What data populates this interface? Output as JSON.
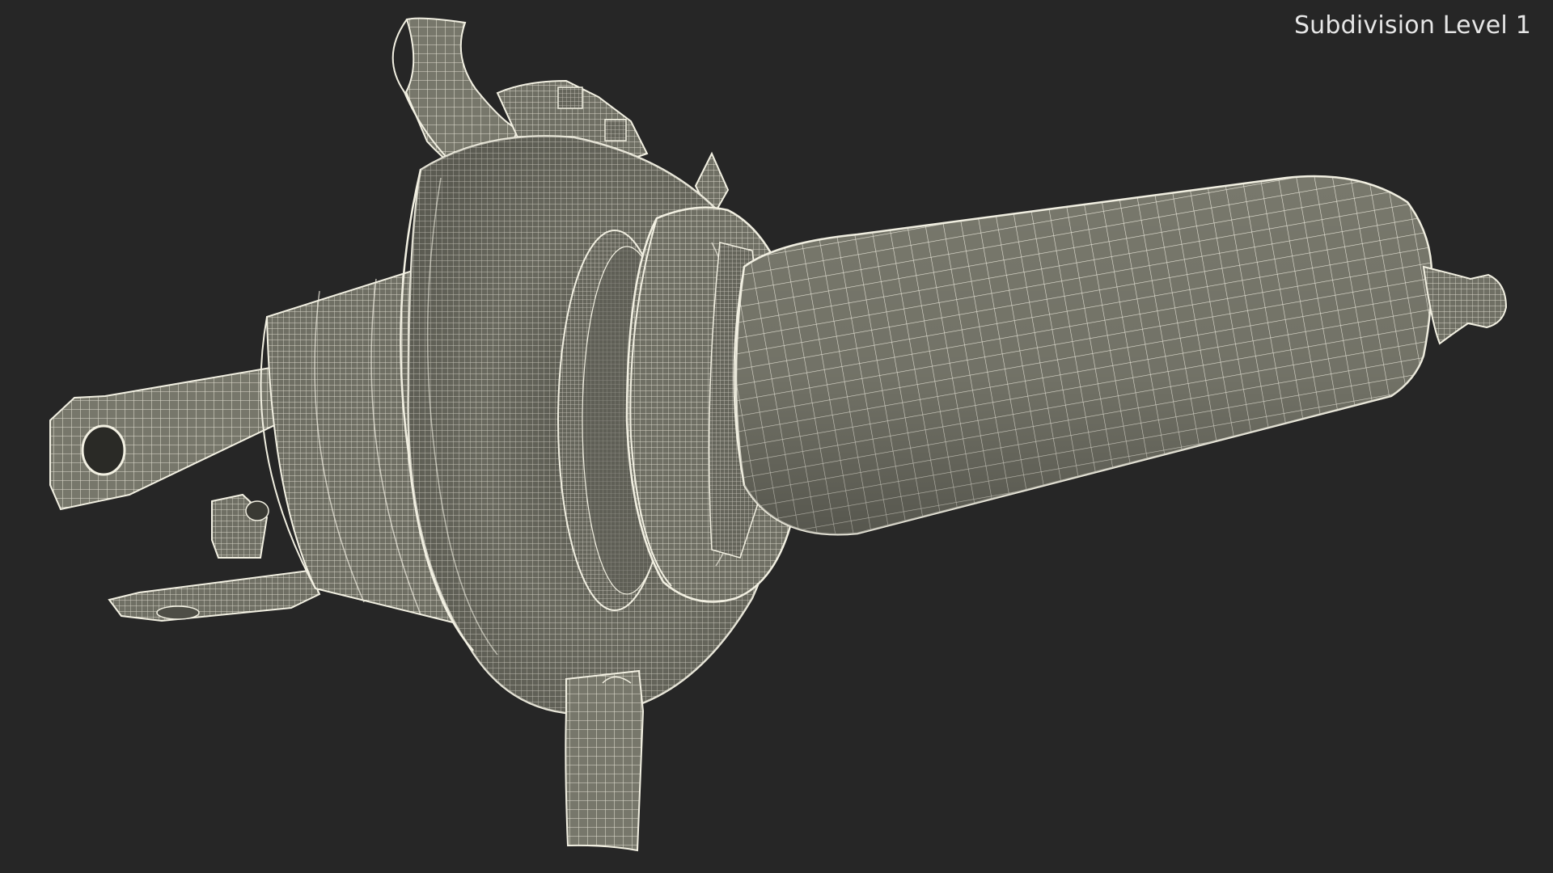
{
  "viewport": {
    "label": "Subdivision Level 1"
  },
  "colors": {
    "background": "#262626",
    "surface": "#77776b",
    "surface_dark": "#5f5f55",
    "wire": "#f2f0e2",
    "label": "#e6e6e6"
  },
  "model": {
    "subject": "halogen-headlight-bulb-wireframe"
  }
}
